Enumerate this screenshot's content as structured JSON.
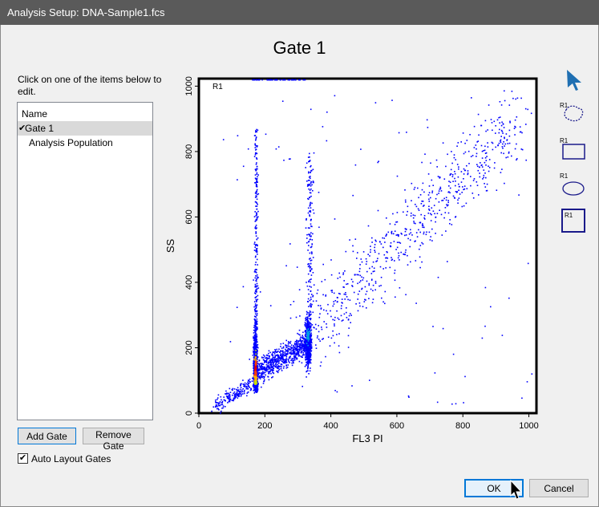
{
  "window": {
    "title": "Analysis Setup:  DNA-Sample1.fcs"
  },
  "gate_title": "Gate 1",
  "instructions": "Click on one of the items below to edit.",
  "list": {
    "header": "Name",
    "items": [
      {
        "label": "Gate 1",
        "checked": true,
        "selected": true
      },
      {
        "label": "Analysis Population",
        "checked": false,
        "selected": false
      }
    ]
  },
  "buttons": {
    "add_gate": "Add Gate",
    "remove_gate": "Remove Gate",
    "ok": "OK",
    "cancel": "Cancel"
  },
  "auto_layout": {
    "label": "Auto Layout Gates",
    "checked": true
  },
  "plot": {
    "region_label": "R1",
    "xlabel": "FL3 PI",
    "ylabel": "SS",
    "xticks": [
      "0",
      "200",
      "400",
      "600",
      "800",
      "1000"
    ],
    "yticks": [
      "0",
      "200",
      "400",
      "600",
      "800",
      "1000"
    ],
    "xlim": [
      0,
      1023
    ],
    "ylim": [
      0,
      1023
    ],
    "dot_color": "#0000ff"
  },
  "tools": {
    "labels": [
      "R1",
      "R1",
      "R1",
      "R1"
    ],
    "accent": "#1f6fb2"
  }
}
